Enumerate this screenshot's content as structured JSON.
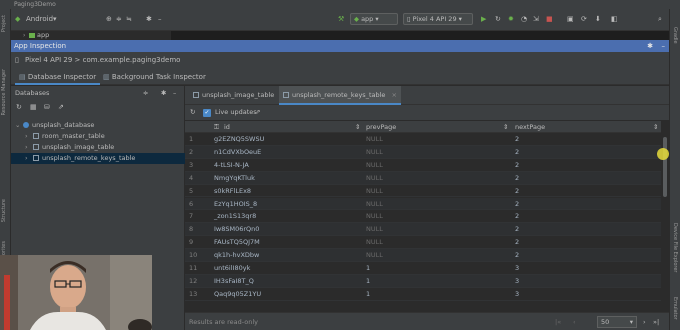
{
  "window": {
    "title": "Paging3Demo"
  },
  "toolbar": {
    "module": "Android",
    "run_config": "app",
    "device": "Pixel 4 API 29"
  },
  "project": {
    "item": "app"
  },
  "side_tabs": {
    "project": "Project",
    "resource_manager": "Resource Manager",
    "structure": "Structure",
    "favorites": "Favorites",
    "gradle": "Gradle",
    "device_file_explorer": "Device File Explorer",
    "emulator": "Emulator"
  },
  "app_inspection": {
    "title": "App Inspection",
    "process": "Pixel 4 API 29 > com.example.paging3demo",
    "tabs": [
      "Database Inspector",
      "Background Task Inspector"
    ]
  },
  "databases": {
    "header": "Databases",
    "root": "unsplash_database",
    "tables": [
      "room_master_table",
      "unsplash_image_table",
      "unsplash_remote_keys_table"
    ],
    "selected_index": 2
  },
  "table_tabs": [
    "unsplash_image_table",
    "unsplash_remote_keys_table"
  ],
  "live_updates": {
    "label": "Live updates",
    "checked": true
  },
  "grid": {
    "columns": [
      "id",
      "prevPage",
      "nextPage"
    ],
    "rows": [
      {
        "n": "1",
        "id": "g2EZNQ5SWSU",
        "prev": "NULL",
        "next": "2"
      },
      {
        "n": "2",
        "id": "n1CdVXbOeuE",
        "prev": "NULL",
        "next": "2"
      },
      {
        "n": "3",
        "id": "4-tLSI-N-JA",
        "prev": "NULL",
        "next": "2"
      },
      {
        "n": "4",
        "id": "NmgYqKTluk",
        "prev": "NULL",
        "next": "2"
      },
      {
        "n": "5",
        "id": "s0kRFlLEx8",
        "prev": "NULL",
        "next": "2"
      },
      {
        "n": "6",
        "id": "EzYq1HOIS_8",
        "prev": "NULL",
        "next": "2"
      },
      {
        "n": "7",
        "id": "_zon1S13qr8",
        "prev": "NULL",
        "next": "2"
      },
      {
        "n": "8",
        "id": "Iw8SM06rQn0",
        "prev": "NULL",
        "next": "2"
      },
      {
        "n": "9",
        "id": "FAUsTQ5QJ7M",
        "prev": "NULL",
        "next": "2"
      },
      {
        "n": "10",
        "id": "qk1h-hvXDbw",
        "prev": "NULL",
        "next": "2"
      },
      {
        "n": "11",
        "id": "unt6ilI80yk",
        "prev": "1",
        "next": "3"
      },
      {
        "n": "12",
        "id": "IH3sFaI8T_Q",
        "prev": "1",
        "next": "3"
      },
      {
        "n": "13",
        "id": "Qaq9q05Z1YU",
        "prev": "1",
        "next": "3"
      }
    ]
  },
  "footer": {
    "status": "Results are read-only",
    "page_size": "50"
  },
  "colors": {
    "accent": "#4a88c7",
    "header": "#4b6eaf",
    "selection": "#0d293e"
  }
}
